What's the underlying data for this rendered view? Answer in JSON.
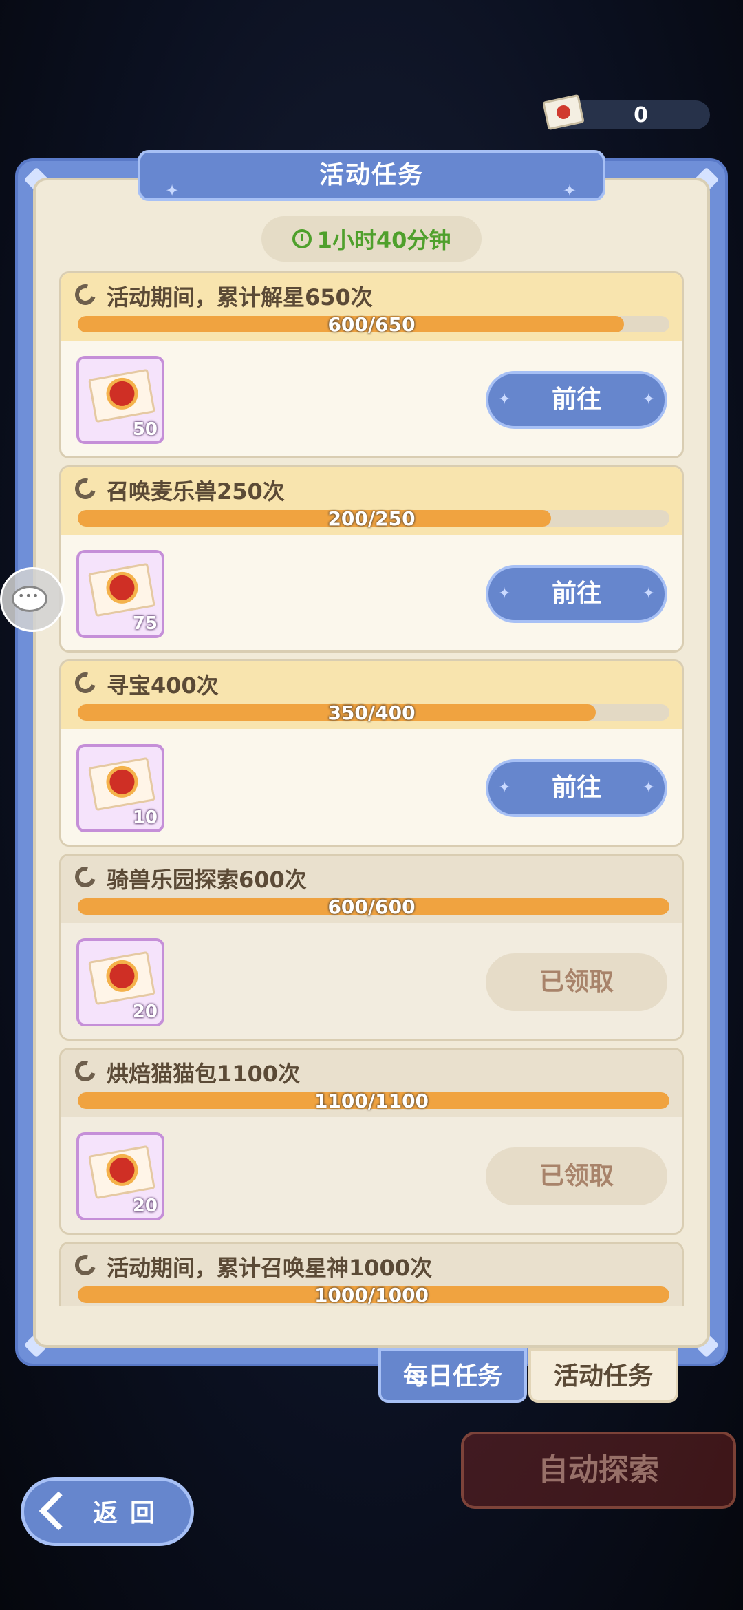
{
  "currency": {
    "value": "0",
    "icon": "red-envelope-icon"
  },
  "panel": {
    "title": "活动任务",
    "timer": "1小时40分钟"
  },
  "tasks": [
    {
      "title": "活动期间，累计解星650次",
      "progress_text": "600/650",
      "progress": 0.923,
      "reward_count": "50",
      "button": "前往",
      "state": "go"
    },
    {
      "title": "召唤麦乐兽250次",
      "progress_text": "200/250",
      "progress": 0.8,
      "reward_count": "75",
      "button": "前往",
      "state": "go"
    },
    {
      "title": "寻宝400次",
      "progress_text": "350/400",
      "progress": 0.875,
      "reward_count": "10",
      "button": "前往",
      "state": "go"
    },
    {
      "title": "骑兽乐园探索600次",
      "progress_text": "600/600",
      "progress": 1.0,
      "reward_count": "20",
      "button": "已领取",
      "state": "claimed"
    },
    {
      "title": "烘焙猫猫包1100次",
      "progress_text": "1100/1100",
      "progress": 1.0,
      "reward_count": "20",
      "button": "已领取",
      "state": "claimed"
    },
    {
      "title": "活动期间，累计召唤星神1000次",
      "progress_text": "1000/1000",
      "progress": 1.0,
      "reward_count": "",
      "button": "",
      "state": "claimed"
    }
  ],
  "tabs": {
    "daily": "每日任务",
    "event": "活动任务"
  },
  "auto_explore": "自动探索",
  "back": "返回"
}
